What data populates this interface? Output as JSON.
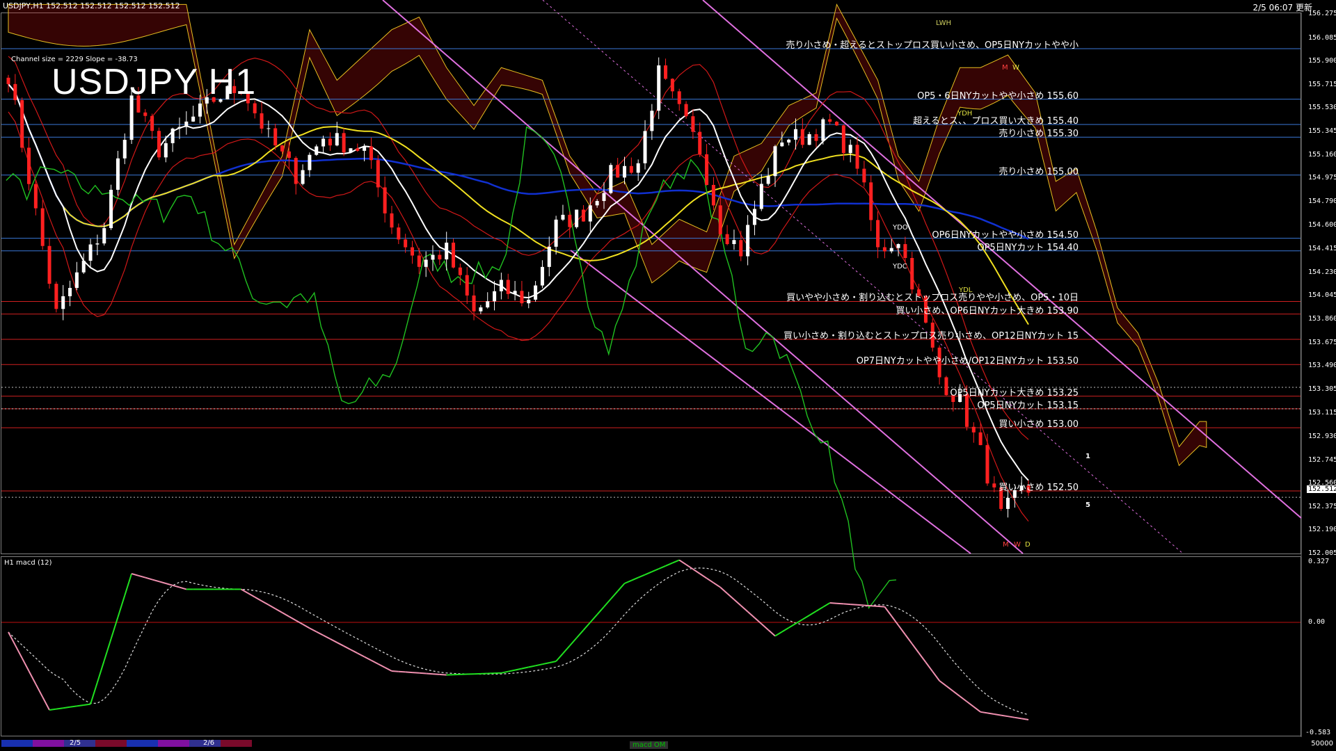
{
  "header": {
    "info": "USDJPY,H1  152.512 152.512 152.512 152.512",
    "clock": "2/5 06:07 更新"
  },
  "overlay": {
    "title": "USDJPY H1",
    "channel_info": "Channel size = 2229 Slope = -38.73"
  },
  "price_axis": {
    "labels": [
      "156.275",
      "156.085",
      "155.900",
      "155.715",
      "155.530",
      "155.345",
      "155.160",
      "154.975",
      "154.790",
      "154.600",
      "154.415",
      "154.230",
      "154.045",
      "153.860",
      "153.675",
      "153.490",
      "153.305",
      "153.115",
      "152.930",
      "152.745",
      "152.560",
      "152.375",
      "152.190",
      "152.005"
    ],
    "min": 152.005,
    "max": 156.275,
    "current": "152.512"
  },
  "levels": [
    {
      "price": 156.0,
      "text": "売り小さめ・超えるとストップロス買い小さめ、OP5日NYカットやや小",
      "color": "#3a78d8"
    },
    {
      "price": 155.6,
      "text": "OP5・6日NYカットやや小さめ 155.60",
      "color": "#3a78d8"
    },
    {
      "price": 155.4,
      "text": "超えるとス、、プロス買い大きめ 155.40",
      "color": "#3a78d8"
    },
    {
      "price": 155.3,
      "text": "売り小さめ 155.30",
      "color": "#3a78d8"
    },
    {
      "price": 155.0,
      "text": "売り小さめ 155.00",
      "color": "#3a78d8"
    },
    {
      "price": 154.5,
      "text": "OP6日NYカットやや小さめ 154.50",
      "color": "#3a78d8"
    },
    {
      "price": 154.4,
      "text": "OP5日NYカット 154.40",
      "color": "#3a78d8"
    },
    {
      "price": 154.0,
      "text": "買いやや小さめ・割り込むとストップロス売りやや小さめ、OP5・10日",
      "color": "#d02020"
    },
    {
      "price": 153.9,
      "text": "買い小さめ、OP6日NYカット大きめ 153.90",
      "color": "#d02020"
    },
    {
      "price": 153.7,
      "text": "買い小さめ・割り込むとストップロス売り小さめ、OP12日NYカット 15",
      "color": "#d02020"
    },
    {
      "price": 153.5,
      "text": "OP7日NYカットやや小さめ/OP12日NYカット 153.50",
      "color": "#d02020"
    },
    {
      "price": 153.25,
      "text": "OP5日NYカット大きめ 153.25",
      "color": "#d02020"
    },
    {
      "price": 153.15,
      "text": "OP5日NYカット 153.15",
      "color": "#d02020"
    },
    {
      "price": 153.0,
      "text": "買い小さめ 153.00",
      "color": "#d02020"
    },
    {
      "price": 152.5,
      "text": "買い小さめ 152.50",
      "color": "#d02020"
    }
  ],
  "tags": {
    "lwh": "LWH",
    "ydh": "YDH",
    "ydo": "YDO",
    "ydc": "YDC",
    "ydl": "YDL",
    "m_top": "M",
    "w_top": "W",
    "m_bottom": "M",
    "w_bottom": "W",
    "d_bottom": "D",
    "line_1": "1",
    "line_5": "5"
  },
  "indicator": {
    "title": "H1  macd (12)",
    "axis_top": "0.327",
    "axis_zero": "0.00",
    "axis_bottom": "-0.583"
  },
  "timeline": {
    "date_1": "2/5",
    "date_2": "2/6",
    "tab": "macd OM",
    "scale": "50000"
  },
  "colors": {
    "background": "#000000",
    "bull_candle": "#ffffff",
    "bear_candle": "#ff2020",
    "ma_yellow": "#f0e020",
    "ma_blue": "#1030d0",
    "ma_white": "#ffffff",
    "chikou_green": "#20c020",
    "bollinger_red": "#d01818",
    "channel_violet": "#e070e0",
    "cloud_red": "#c01010",
    "cloud_white": "#b0b0b0",
    "macd_green": "#20e020",
    "macd_pink": "#f090b0"
  }
}
